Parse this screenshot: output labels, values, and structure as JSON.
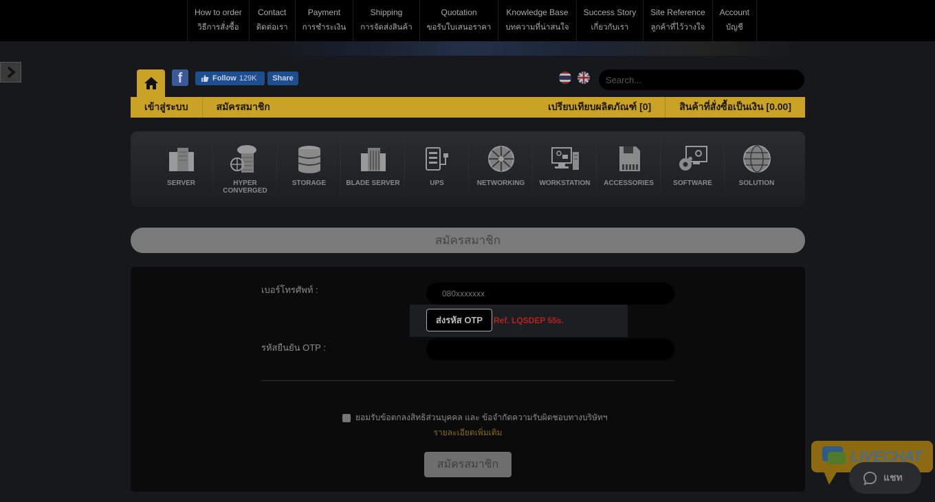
{
  "topnav": {
    "items": [
      {
        "en": "How to order",
        "th": "วิธีการสั่งซื้อ"
      },
      {
        "en": "Contact",
        "th": "ติดต่อเรา"
      },
      {
        "en": "Payment",
        "th": "การชำระเงิน"
      },
      {
        "en": "Shipping",
        "th": "การจัดส่งสินค้า"
      },
      {
        "en": "Quotation",
        "th": "ขอรับใบเสนอราคา"
      },
      {
        "en": "Knowledge Base",
        "th": "บทความที่น่าสนใจ"
      },
      {
        "en": "Success Story",
        "th": "เกี่ยวกับเรา"
      },
      {
        "en": "Site Reference",
        "th": "ลูกค้าที่ไว้วางใจ"
      },
      {
        "en": "Account",
        "th": "บัญชี"
      }
    ]
  },
  "social": {
    "follow_label": "Follow",
    "follow_count": "129K",
    "share_label": "Share"
  },
  "search": {
    "placeholder": "Search..."
  },
  "goldbar": {
    "login": "เข้าสู่ระบบ",
    "register": "สมัครสมาชิก",
    "compare": "เปรียบเทียบผลิตภัณฑ์ [0]",
    "cart": "สินค้าที่สั่งซื้อเป็นเงิน [0.00]"
  },
  "categories": [
    {
      "label": "SERVER",
      "icon": "server-icon"
    },
    {
      "label": "HYPER CONVERGED",
      "icon": "hyper-converged-icon"
    },
    {
      "label": "STORAGE",
      "icon": "storage-icon"
    },
    {
      "label": "BLADE SERVER",
      "icon": "blade-server-icon"
    },
    {
      "label": "UPS",
      "icon": "ups-icon"
    },
    {
      "label": "NETWORKING",
      "icon": "networking-icon"
    },
    {
      "label": "WORKSTATION",
      "icon": "workstation-icon"
    },
    {
      "label": "ACCESSORIES",
      "icon": "accessories-icon"
    },
    {
      "label": "SOFTWARE",
      "icon": "software-icon"
    },
    {
      "label": "SOLUTION",
      "icon": "solution-icon"
    }
  ],
  "page": {
    "title": "สมัครสมาชิก"
  },
  "form": {
    "phone_label": "เบอร์โทรศัพท์ :",
    "phone_placeholder": "080xxxxxxx",
    "otp_send_label": "ส่งรหัส OTP",
    "otp_ref": "Ref. LQSDEP 55s.",
    "otp_label": "รหัสยืนยัน OTP :",
    "agree_text": "ยอมรับข้อตกลงสิทธิส่วนบุคคล และ ข้อจำกัดความรับผิดชอบทางบริษัทฯ",
    "more_link": "รายละเอียดเพิ่มเติม",
    "submit_label": "สมัครสมาชิก"
  },
  "chat": {
    "livechat_label": "LIVECHAT",
    "chat_label": "แชท"
  },
  "colors": {
    "accent_gold": "#c9a226",
    "otp_ref_red": "#b22323",
    "facebook_blue": "#1d4e8f"
  }
}
